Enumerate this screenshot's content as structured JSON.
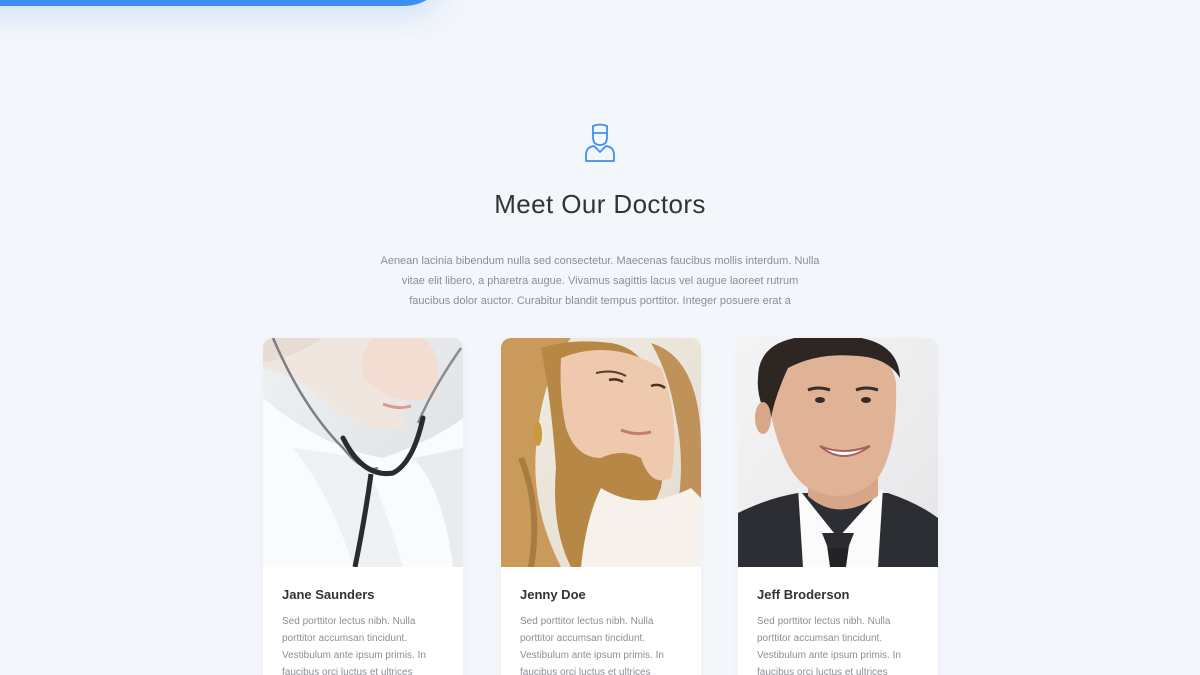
{
  "colors": {
    "accent": "#3d8ff3",
    "background": "#f3f6fa",
    "heading": "#333333",
    "body_text": "#8a8f96"
  },
  "section": {
    "icon": "doctor-icon",
    "title": "Meet Our Doctors",
    "description": "Aenean lacinia bibendum nulla sed consectetur. Maecenas faucibus mollis interdum. Nulla vitae elit libero, a pharetra augue. Vivamus sagittis lacus vel augue laoreet rutrum faucibus dolor auctor. Curabitur blandit tempus porttitor. Integer posuere erat a"
  },
  "doctors": [
    {
      "name": "Jane Saunders",
      "bio": "Sed porttitor lectus nibh. Nulla porttitor accumsan tincidunt. Vestibulum ante ipsum primis. In faucibus orci luctus et ultrices",
      "photo": "doctor-with-stethoscope-photo"
    },
    {
      "name": "Jenny Doe",
      "bio": "Sed porttitor lectus nibh. Nulla porttitor accumsan tincidunt. Vestibulum ante ipsum primis. In faucibus orci luctus et ultrices",
      "photo": "woman-portrait-photo"
    },
    {
      "name": "Jeff Broderson",
      "bio": "Sed porttitor lectus nibh. Nulla porttitor accumsan tincidunt. Vestibulum ante ipsum primis. In faucibus orci luctus et ultrices",
      "photo": "smiling-man-portrait-photo"
    }
  ]
}
